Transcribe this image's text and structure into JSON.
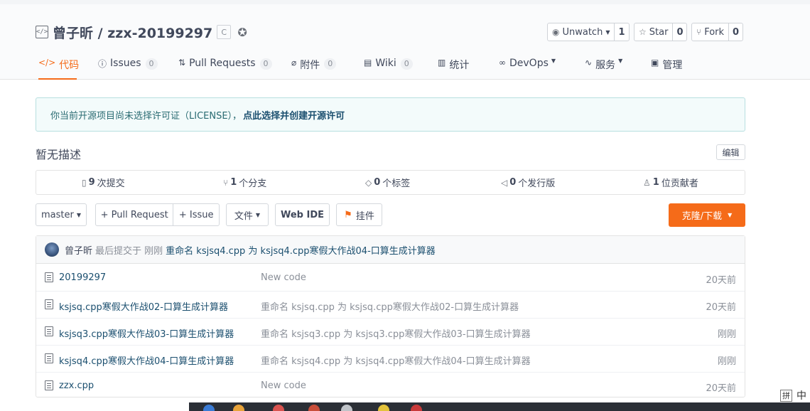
{
  "repo": {
    "owner": "曾子昕",
    "separator": "/",
    "name": "zzx-20199297",
    "badge": "C"
  },
  "actions": {
    "watch": {
      "label": "Unwatch",
      "count": "1"
    },
    "star": {
      "label": "Star",
      "count": "0"
    },
    "fork": {
      "label": "Fork",
      "count": "0"
    }
  },
  "tabs": [
    {
      "label": "代码",
      "active": true
    },
    {
      "label": "Issues",
      "count": "0"
    },
    {
      "label": "Pull Requests",
      "count": "0"
    },
    {
      "label": "附件",
      "count": "0"
    },
    {
      "label": "Wiki",
      "count": "0"
    },
    {
      "label": "统计"
    },
    {
      "label": "DevOps"
    },
    {
      "label": "服务"
    },
    {
      "label": "管理"
    }
  ],
  "notice": {
    "text": "你当前开源项目尚未选择许可证（LICENSE），",
    "link": "点此选择并创建开源许可"
  },
  "description": "暂无描述",
  "edit_label": "编辑",
  "stats": [
    {
      "count": "9",
      "label": "次提交"
    },
    {
      "count": "1",
      "label": "个分支"
    },
    {
      "count": "0",
      "label": "个标签"
    },
    {
      "count": "0",
      "label": "个发行版"
    },
    {
      "count": "1",
      "label": "位贡献者"
    }
  ],
  "toolbar": {
    "branch": "master",
    "pull_request": "+ Pull Request",
    "issue": "+ Issue",
    "file": "文件",
    "web_ide": "Web IDE",
    "pendant": "挂件",
    "clone": "克隆/下载"
  },
  "last_commit": {
    "author": "曾子昕",
    "meta": "最后提交于 刚刚",
    "message": "重命名 ksjsq4.cpp 为 ksjsq4.cpp寒假大作战04-口算生成计算器"
  },
  "files": [
    {
      "name": "20199297",
      "message": "New code",
      "time": "20天前"
    },
    {
      "name": "ksjsq.cpp寒假大作战02-口算生成计算器",
      "message": "重命名 ksjsq.cpp 为 ksjsq.cpp寒假大作战02-口算生成计算器",
      "time": "20天前"
    },
    {
      "name": "ksjsq3.cpp寒假大作战03-口算生成计算器",
      "message": "重命名 ksjsq3.cpp 为 ksjsq3.cpp寒假大作战03-口算生成计算器",
      "time": "刚刚"
    },
    {
      "name": "ksjsq4.cpp寒假大作战04-口算生成计算器",
      "message": "重命名 ksjsq4.cpp 为 ksjsq4.cpp寒假大作战04-口算生成计算器",
      "time": "刚刚"
    },
    {
      "name": "zzx.cpp",
      "message": "New code",
      "time": "20天前"
    }
  ],
  "ime": {
    "mode": "拼",
    "lang": "中"
  },
  "colors": {
    "accent": "#f56b19",
    "link": "#1b4f6f"
  }
}
